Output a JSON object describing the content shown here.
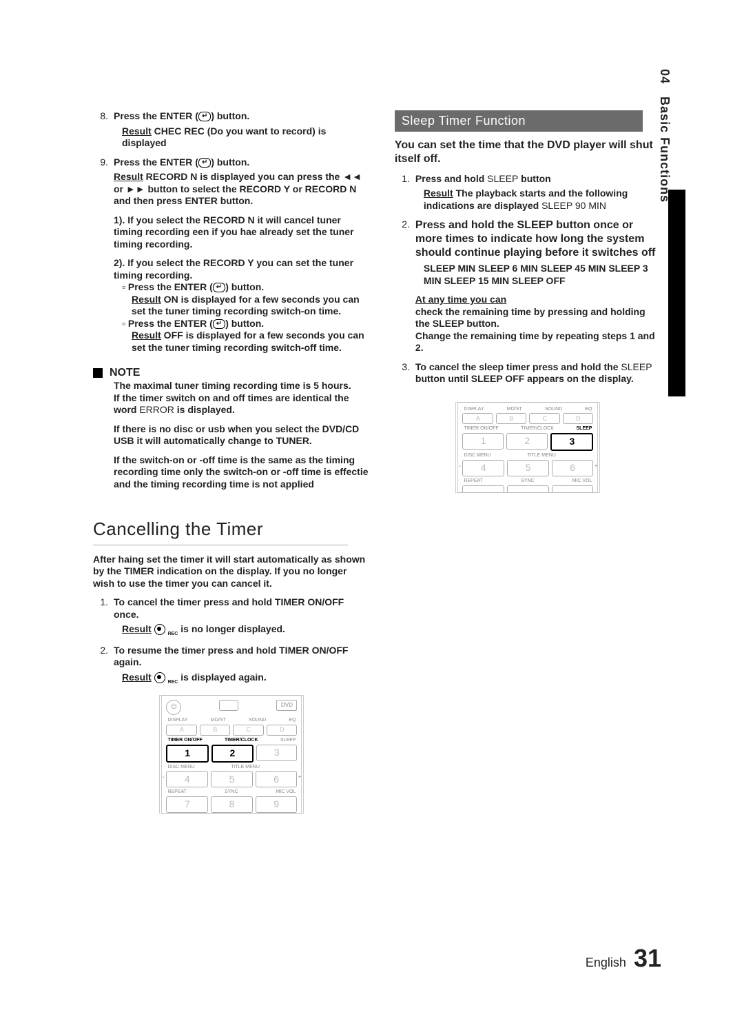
{
  "side_tab": {
    "num": "04",
    "label": "Basic Functions"
  },
  "left": {
    "step8": {
      "n": "8.",
      "text1": "Press the ",
      "text2": "ENTER (",
      "text3": ") button.",
      "result_label": "Result",
      "result_text": " CHEC REC (Do you want to record) is displayed"
    },
    "step9": {
      "n": "9.",
      "text1": "Press the ",
      "text2": "ENTER (",
      "text3": ") button.",
      "result_label": "Result",
      "result_text": " RECORD N is displayed you can press the ◄◄ or ►► button to select the RECORD Y or RECORD N and then press ENTER button.",
      "sub1_n": "1).",
      "sub1_text": "If you select the RECORD N it will cancel tuner timing recording een if you hae already set the tuner timing recording.",
      "sub2_n": "2).",
      "sub2_text": "If you select the RECORD Y you can set the tuner timing recording.",
      "bullet_a_text1": "Press the ",
      "bullet_a_text2": "ENTER (",
      "bullet_a_text3": ") button.",
      "bullet_a_result_label": "Result",
      "bullet_a_result_text": " ON is displayed for a few seconds you can set the tuner timing recording switch-on time.",
      "bullet_b_text1": "Press the ",
      "bullet_b_text2": "ENTER (",
      "bullet_b_text3": ") button.",
      "bullet_b_result_label": "Result",
      "bullet_b_result_text": " OFF is displayed for a few seconds you can set the tuner timing recording switch-off time."
    },
    "note": {
      "label": "NOTE",
      "l1a": "The maximal tuner timing recording time is 5 hours.",
      "l1b": "If the timer switch on and off times are identical the word ",
      "l1c": "ERROR",
      "l1d": " is displayed.",
      "l2": "If there is no disc or usb when you select the DVD/CD USB it will automatically change to TUNER.",
      "l3": "If the switch-on or -off time is the same as the timing recording time only the switch-on or -off time is effectie and the timing recording time is not applied"
    },
    "cancel": {
      "title": "Cancelling the Timer",
      "intro": "After haing set the timer it will start automatically as shown by the TIMER indication on the display. If you no longer wish to use the timer you can cancel it.",
      "s1_n": "1.",
      "s1_text": "To cancel the timer press and hold TIMER ON/OFF once.",
      "s1_result_label": "Result",
      "s1_result_text": "  is no longer displayed.",
      "s2_n": "2.",
      "s2_text": "To resume the timer press and hold TIMER ON/OFF again.",
      "s2_result_label": "Result",
      "s2_result_text": "  is displayed again."
    }
  },
  "right": {
    "section_title": "Sleep Timer Function",
    "intro": "You can set the time that the DVD player will shut itself off.",
    "s1_n": "1.",
    "s1_text1": "Press and hold ",
    "s1_text2": "SLEEP",
    "s1_text3": " button",
    "s1_result_label": "Result",
    "s1_result_text1": " The  playback starts and the following indications are displayed ",
    "s1_result_text2": "SLEEP 90 MIN",
    "s2_n": "2.",
    "s2_text": "Press and hold the SLEEP button once or more times to indicate how long the system should continue playing before it switches off",
    "s2_options": "SLEEP  MIN      SLEEP 6 MIN      SLEEP 45 MIN    SLEEP 3 MIN    SLEEP 15 MIN SLEEP OFF",
    "anytime_label": "At any time you can",
    "anytime_a": "check the remaining time by pressing and holding the SLEEP button.",
    "anytime_b": "Change the remaining time by repeating steps 1 and 2.",
    "s3_n": "3.",
    "s3_text1": "To cancel the sleep timer press and hold the ",
    "s3_text2": "SLEEP",
    "s3_text3": " button until SLEEP OFF appears on the display."
  },
  "remote_labels": {
    "row1": [
      "DISPLAY",
      "MO/ST",
      "SOUND",
      "EQ"
    ],
    "row1btn": [
      "A",
      "B",
      "C",
      "D"
    ],
    "row2": [
      "TIMER ON/OFF",
      "TIMER/CLOCK",
      "SLEEP"
    ],
    "row2btn": [
      "1",
      "2",
      "3"
    ],
    "row3": [
      "DISC MENU",
      "TITLE MENU",
      ""
    ],
    "row3btn": [
      "4",
      "5",
      "6"
    ],
    "row4": [
      "REPEAT",
      "SYNC",
      "MIC VOL"
    ],
    "row4btn": [
      "7",
      "8",
      "9"
    ],
    "dvd": "DVD"
  },
  "footer": {
    "lang": "English",
    "page": "31"
  }
}
